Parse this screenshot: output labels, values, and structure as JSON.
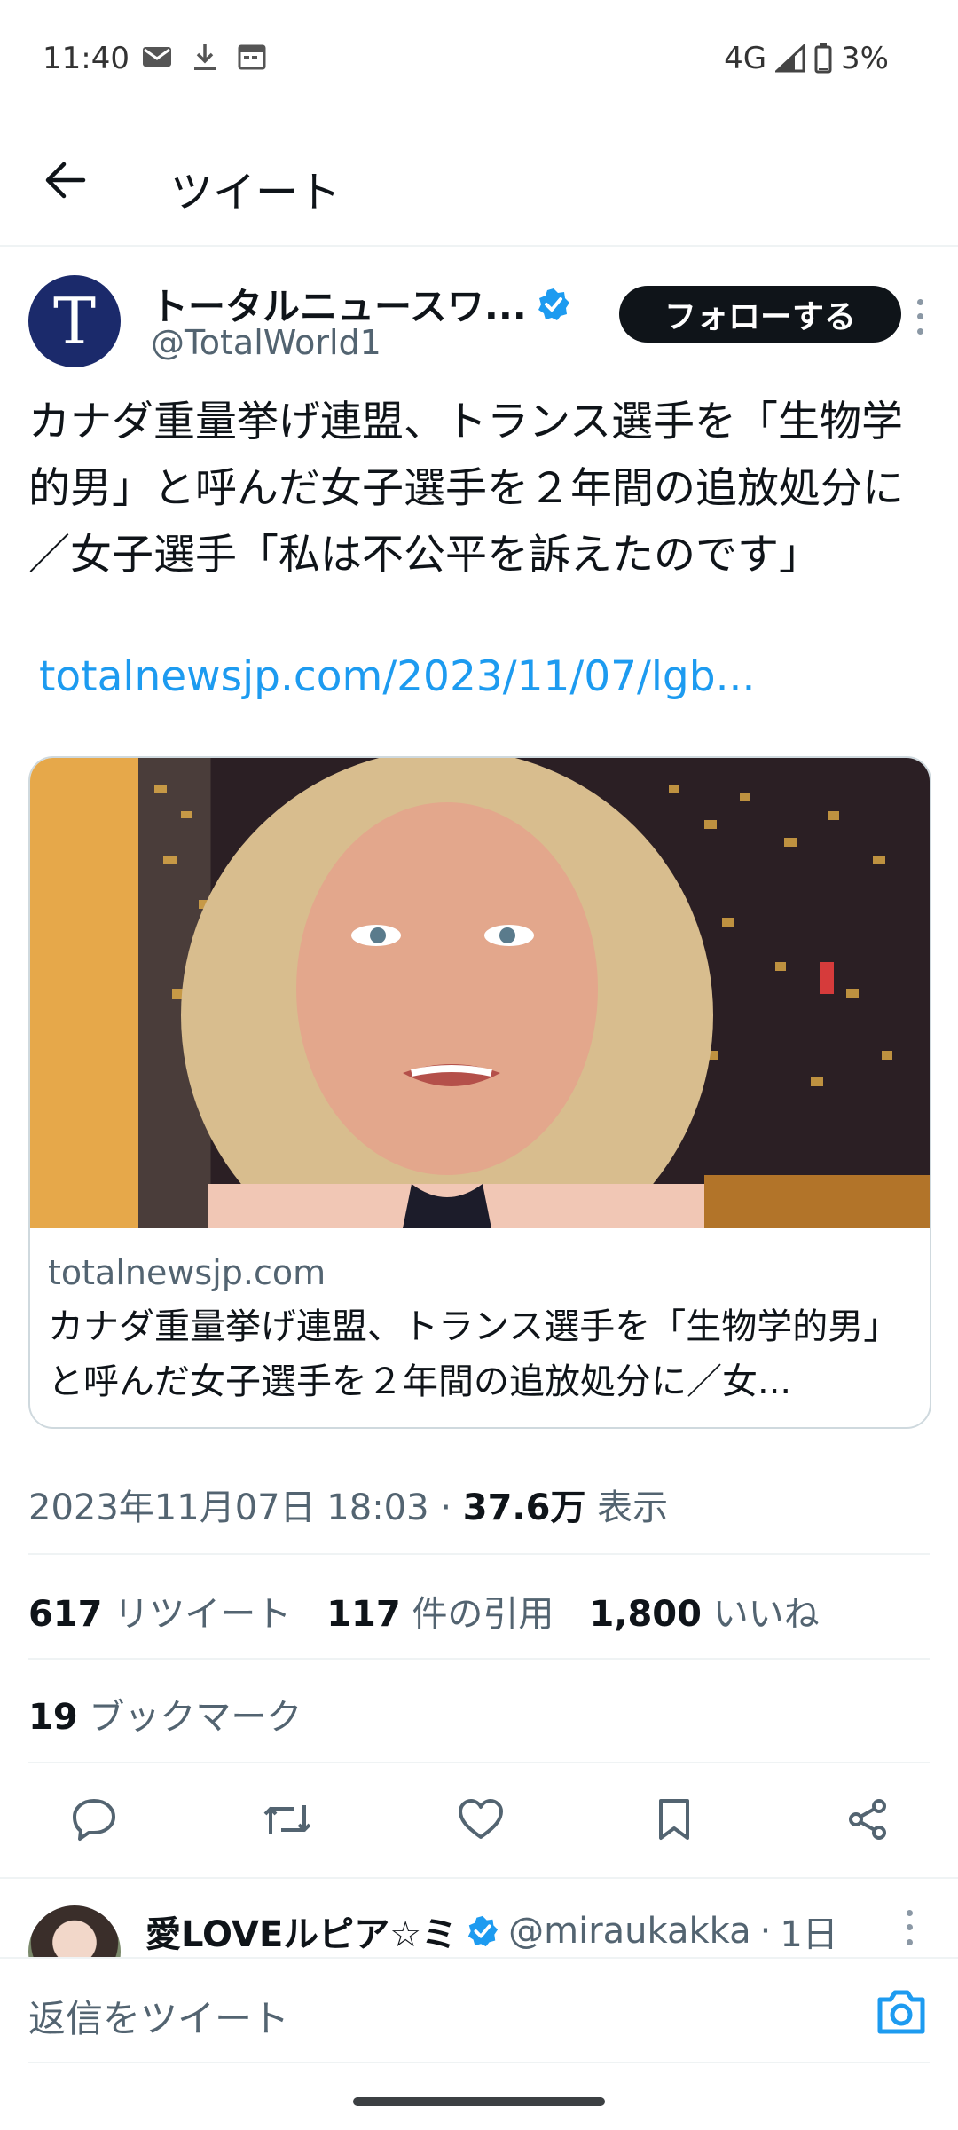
{
  "status_bar": {
    "time": "11:40",
    "network": "4G",
    "battery": "3%",
    "icons": [
      "mail-icon",
      "download-icon",
      "calendar-icon",
      "signal-icon",
      "battery-icon"
    ]
  },
  "header": {
    "title": "ツイート"
  },
  "author": {
    "avatar_letter": "T",
    "name": "トータルニュースワ...",
    "handle": "@TotalWorld1",
    "follow_label": "フォローする",
    "verified_color": "#1d9bf0"
  },
  "tweet": {
    "text": "カナダ重量挙げ連盟、トランス選手を「生物学的男」と呼んだ女子選手を２年間の追放処分に／女子選手「私は不公平を訴えたのです」",
    "link": "totalnewsjp.com/2023/11/07/lgb..."
  },
  "card": {
    "domain": "totalnewsjp.com",
    "title": "カナダ重量挙げ連盟、トランス選手を「生物学的男」と呼んだ女子選手を２年間の追放処分に／女..."
  },
  "meta": {
    "datetime": "2023年11月07日 18:03",
    "separator": "·",
    "views_count": "37.6万",
    "views_label": "表示"
  },
  "stats": {
    "retweets_count": "617",
    "retweets_label": "リツイート",
    "quotes_count": "117",
    "quotes_label": "件の引用",
    "likes_count": "1,800",
    "likes_label": "いいね",
    "bookmarks_count": "19",
    "bookmarks_label": "ブックマーク"
  },
  "actions": [
    "reply-icon",
    "retweet-icon",
    "like-icon",
    "bookmark-icon",
    "share-icon"
  ],
  "reply": {
    "name": "愛LOVEルピア☆ミ",
    "handle": "@miraukakka",
    "separator": "·",
    "time": "1日"
  },
  "compose": {
    "placeholder": "返信をツイート"
  },
  "colors": {
    "accent": "#1d9bf0",
    "text": "#0f1419",
    "secondary": "#536471"
  }
}
